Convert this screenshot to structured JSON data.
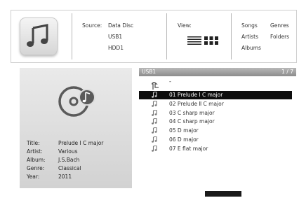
{
  "source": {
    "label": "Source:",
    "items": [
      "Data Disc",
      "USB1",
      "HDD1"
    ]
  },
  "view": {
    "label": "View:",
    "icons": [
      "list-view-icon",
      "grid-view-icon"
    ]
  },
  "categories": {
    "items": [
      "Songs",
      "Genres",
      "Artists",
      "Folders",
      "Albums"
    ]
  },
  "info": {
    "title_label": "Title:",
    "title": "Prelude Ⅰ C major",
    "artist_label": "Artist:",
    "artist": "Various",
    "album_label": "Album:",
    "album": "J.S.Bach",
    "genre_label": "Genre:",
    "genre": "Classical",
    "year_label": "Year:",
    "year": "2011"
  },
  "list": {
    "path": "USB1",
    "page": "1 / 7",
    "up_label": "-",
    "tracks": [
      "01 Prelude Ⅰ C major",
      "02 Prelude Ⅱ C major",
      "03 C sharp major",
      "04 C sharp major",
      "05 D major",
      "06 D major",
      "07 E flat major"
    ],
    "selected_index": 0
  },
  "colors": {
    "selected_row": "#0d0d0d",
    "header_bar": "#9e9e9e",
    "panel_bg": "#dedede"
  }
}
